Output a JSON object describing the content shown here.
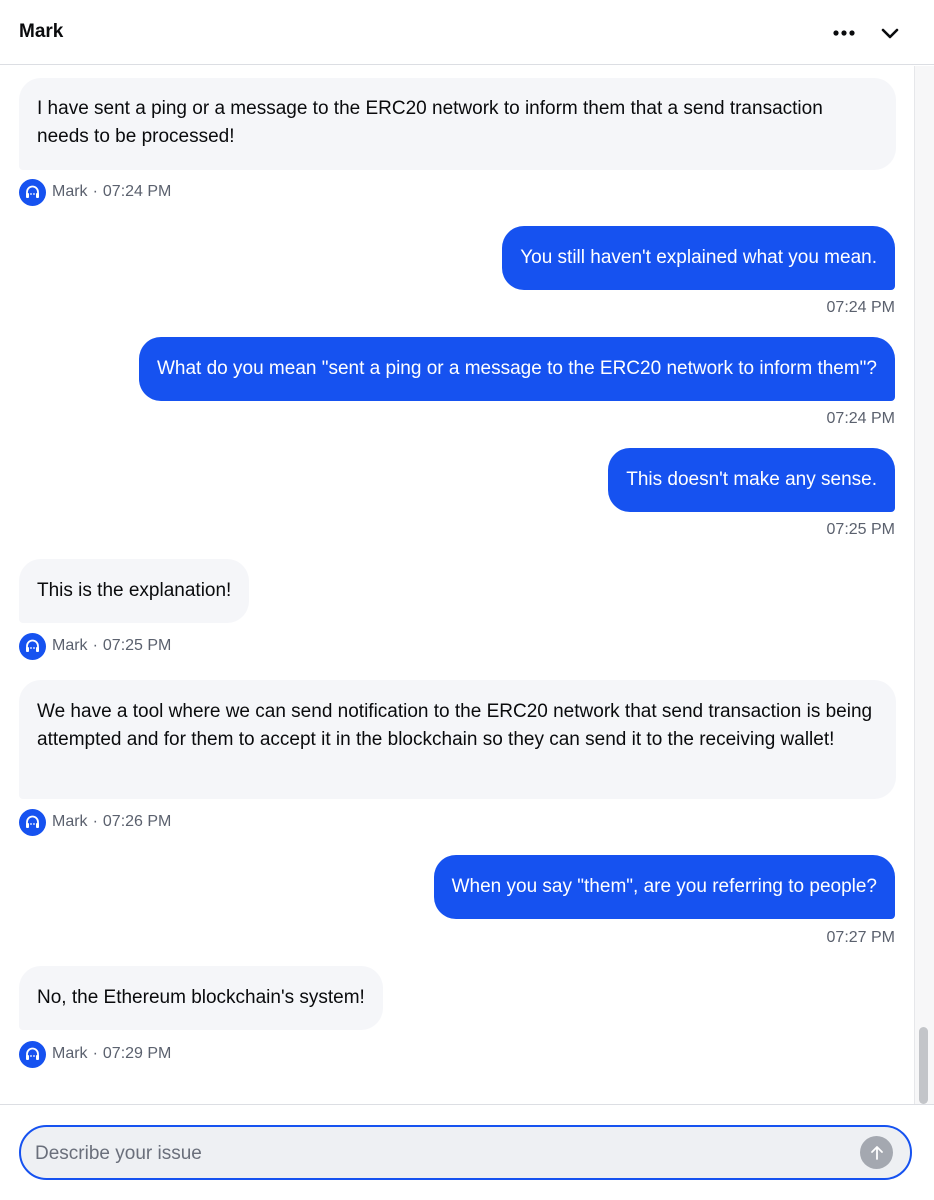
{
  "header": {
    "title": "Mark"
  },
  "messages": [
    {
      "sender": "agent",
      "text": "I have sent a ping or a message to the ERC20 network to inform them that a send transaction needs to be processed!",
      "name": "Mark",
      "time": "07:24 PM"
    },
    {
      "sender": "user",
      "text": "You still haven't explained what you mean.",
      "time": "07:24 PM"
    },
    {
      "sender": "user",
      "text": "What do you mean \"sent a ping or a message to the ERC20 network to inform them\"?",
      "time": "07:24 PM"
    },
    {
      "sender": "user",
      "text": "This doesn't make any sense.",
      "time": "07:25 PM"
    },
    {
      "sender": "agent",
      "text": "This is the explanation!",
      "name": "Mark",
      "time": "07:25 PM"
    },
    {
      "sender": "agent",
      "text": "We have a tool where we can send notification to the ERC20 network that send transaction is being attempted and for them to accept it in the blockchain so they can send it to the receiving wallet!",
      "name": "Mark",
      "time": "07:26 PM"
    },
    {
      "sender": "user",
      "text": "When you say \"them\", are you referring to people?",
      "time": "07:27 PM"
    },
    {
      "sender": "agent",
      "text": "No, the Ethereum blockchain's system!",
      "name": "Mark",
      "time": "07:29 PM"
    }
  ],
  "meta_separator": "·",
  "composer": {
    "placeholder": "Describe your issue"
  },
  "colors": {
    "accent": "#1652f0",
    "agent_bubble": "#f5f6f9"
  }
}
